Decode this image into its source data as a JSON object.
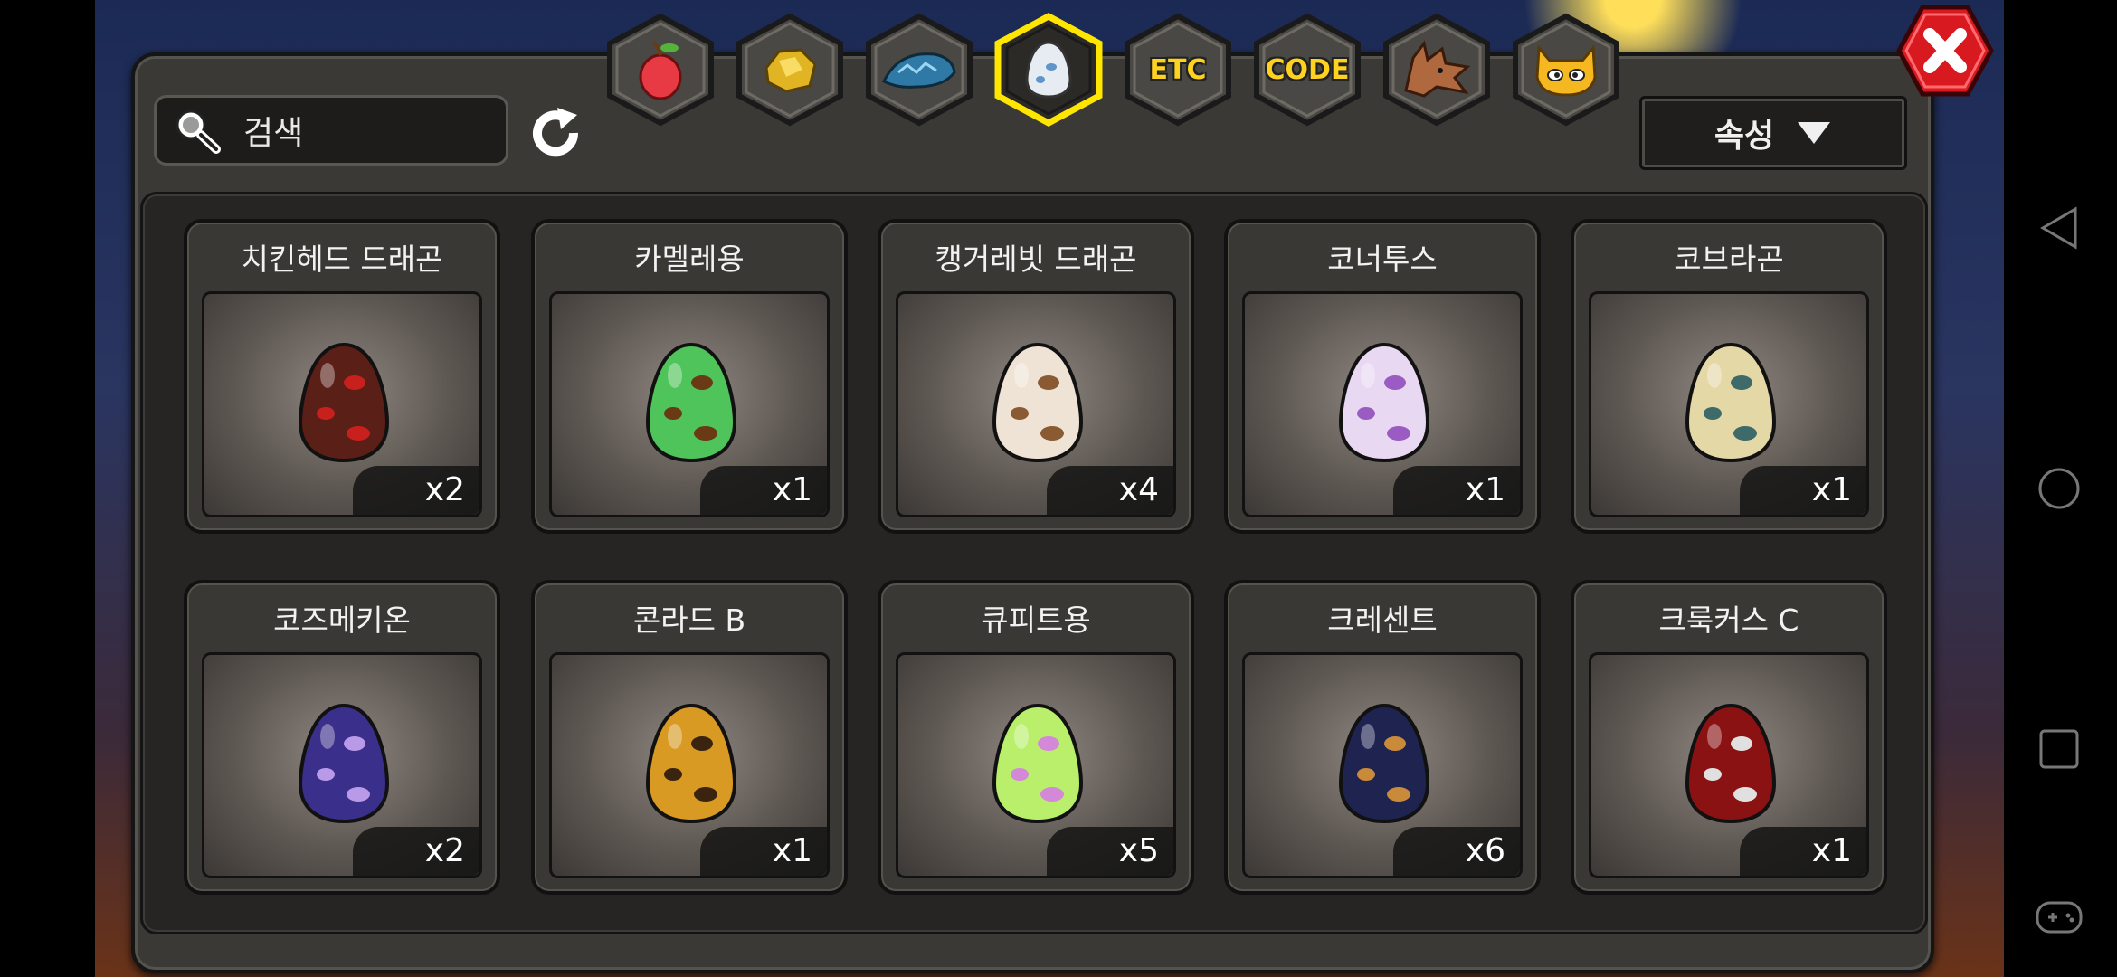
{
  "search": {
    "label": "검색"
  },
  "sort": {
    "label": "속성"
  },
  "tabs": [
    {
      "icon": "fruit-icon"
    },
    {
      "icon": "gold-ore-icon"
    },
    {
      "icon": "dragon-scale-icon"
    },
    {
      "icon": "egg-icon",
      "selected": true
    },
    {
      "label": "ETC"
    },
    {
      "label": "CODE"
    },
    {
      "icon": "dragon-head-icon"
    },
    {
      "icon": "monster-face-icon"
    }
  ],
  "eggs": [
    {
      "name": "치킨헤드 드래곤",
      "count": "x2",
      "color": "#5a1f16",
      "spot": "#c8201c"
    },
    {
      "name": "카멜레용",
      "count": "x1",
      "color": "#4fc45a",
      "spot": "#6a3a14"
    },
    {
      "name": "캥거레빗 드래곤",
      "count": "x4",
      "color": "#efe3d6",
      "spot": "#8a5a33"
    },
    {
      "name": "코너투스",
      "count": "x1",
      "color": "#e9d8f2",
      "spot": "#9a5cc2"
    },
    {
      "name": "코브라곤",
      "count": "x1",
      "color": "#e3d8a6",
      "spot": "#3e6a6a"
    },
    {
      "name": "코즈메키온",
      "count": "x2",
      "color": "#3a2f8a",
      "spot": "#b89ae8"
    },
    {
      "name": "콘라드 B",
      "count": "x1",
      "color": "#d89a22",
      "spot": "#3a2410"
    },
    {
      "name": "큐피트용",
      "count": "x5",
      "color": "#b9ef6a",
      "spot": "#d488d8"
    },
    {
      "name": "크레센트",
      "count": "x6",
      "color": "#1e2350",
      "spot": "#c98a3a"
    },
    {
      "name": "크룩커스 C",
      "count": "x1",
      "color": "#8a1212",
      "spot": "#e0e0e0"
    }
  ]
}
